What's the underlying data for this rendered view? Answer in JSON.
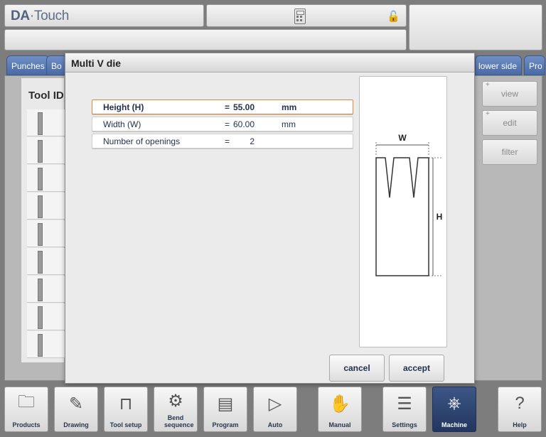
{
  "app": {
    "logo_da": "DA",
    "logo_dot": "·",
    "logo_touch": "Touch"
  },
  "tabs": [
    {
      "label": "Punches"
    },
    {
      "label": "Bo"
    },
    {
      "label": "lower side"
    },
    {
      "label": "Pro"
    }
  ],
  "background": {
    "tool_id_header": "Tool ID",
    "side_buttons": [
      {
        "label": "view"
      },
      {
        "label": "edit"
      },
      {
        "label": "filter"
      }
    ]
  },
  "dialog": {
    "title": "Multi V die",
    "fields": [
      {
        "label": "Height (H)",
        "eq": "=",
        "value": "55.00",
        "unit": "mm",
        "active": true
      },
      {
        "label": "Width (W)",
        "eq": "=",
        "value": "60.00",
        "unit": "mm",
        "active": false
      },
      {
        "label": "Number of openings",
        "eq": "=",
        "value": "2",
        "unit": "",
        "active": false
      }
    ],
    "preview": {
      "width_label": "W",
      "height_label": "H"
    },
    "cancel_label": "cancel",
    "accept_label": "accept"
  },
  "toolbar": [
    {
      "label": "Products",
      "icon": "folder-icon",
      "glyph": "🗀"
    },
    {
      "label": "Drawing",
      "icon": "pencil-icon",
      "glyph": "✎"
    },
    {
      "label": "Tool setup",
      "icon": "tool-setup-icon",
      "glyph": "⊓"
    },
    {
      "label": "Bend sequence",
      "icon": "bend-sequence-icon",
      "glyph": "⚙"
    },
    {
      "label": "Program",
      "icon": "program-icon",
      "glyph": "▤"
    },
    {
      "label": "Auto",
      "icon": "play-icon",
      "glyph": "▷"
    },
    {
      "label": "Manual",
      "icon": "hand-icon",
      "glyph": "✋"
    },
    {
      "label": "Settings",
      "icon": "settings-list-icon",
      "glyph": "☰"
    },
    {
      "label": "Machine",
      "icon": "machine-icon",
      "glyph": "⎈"
    },
    {
      "label": "Help",
      "icon": "help-icon",
      "glyph": "?"
    }
  ]
}
